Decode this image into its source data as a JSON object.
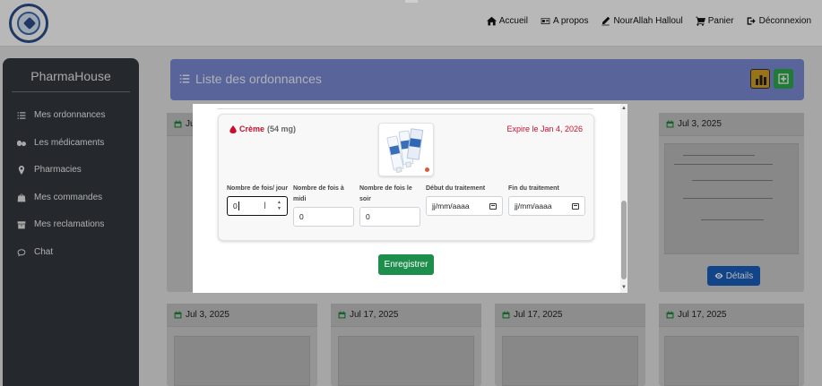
{
  "header": {
    "nav": [
      {
        "icon": "home-icon",
        "label": "Accueil"
      },
      {
        "icon": "id-card-icon",
        "label": "A propos"
      },
      {
        "icon": "pencil-icon",
        "label": "NourAllah Halloul"
      },
      {
        "icon": "cart-icon",
        "label": "Panier"
      },
      {
        "icon": "logout-icon",
        "label": "Déconnexion"
      }
    ]
  },
  "sidebar": {
    "title": "PharmaHouse",
    "items": [
      {
        "icon": "list-icon",
        "label": "Mes ordonnances"
      },
      {
        "icon": "pills-icon",
        "label": "Les médicaments"
      },
      {
        "icon": "map-pin-icon",
        "label": "Pharmacies"
      },
      {
        "icon": "bag-icon",
        "label": "Mes commandes"
      },
      {
        "icon": "archive-icon",
        "label": "Mes reclamations"
      },
      {
        "icon": "chat-icon",
        "label": "Chat"
      }
    ]
  },
  "main": {
    "title": "Liste des ordonnances",
    "cards_row1": [
      {
        "date": "Ju"
      },
      {
        "date": "Jul 3, 2025"
      }
    ],
    "cards_row2": [
      {
        "date": "Jul 3, 2025"
      },
      {
        "date": "Jul 17, 2025"
      },
      {
        "date": "Jul 17, 2025"
      },
      {
        "date": "Jul 17, 2025"
      }
    ],
    "details_label": "Détails"
  },
  "modal": {
    "medicine": {
      "name": "Crème",
      "dose": "(54 mg)",
      "expiry": "Expire le Jan 4, 2026"
    },
    "fields": {
      "per_day": {
        "label": "Nombre de fois/ jour",
        "value": "0"
      },
      "midday": {
        "label": "Nombre de fois à midi",
        "value": "0"
      },
      "evening": {
        "label": "Nombre de fois le soir",
        "value": "0"
      },
      "start": {
        "label": "Début du traitement",
        "placeholder": "jj/mm/aaaa"
      },
      "end": {
        "label": "Fin du traitement",
        "placeholder": "jj/mm/aaaa"
      }
    },
    "save_label": "Enregistrer"
  },
  "colors": {
    "sidebar": "#343a40",
    "header_bar": "#7b8bd6",
    "danger": "#c8102e",
    "save": "#1e8e4c",
    "details": "#1a5fbf"
  }
}
